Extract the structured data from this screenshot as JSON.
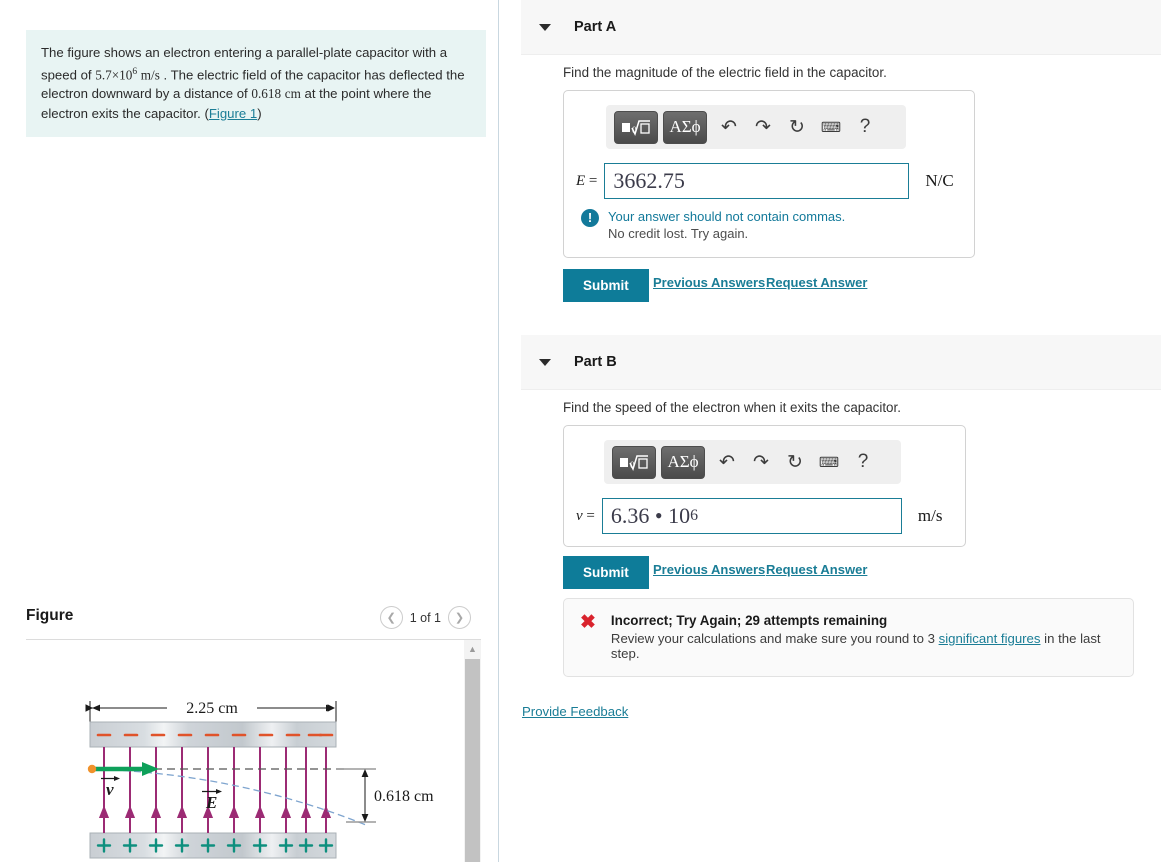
{
  "problem": {
    "text_1": "The figure shows an electron entering a parallel-plate capacitor with a speed of ",
    "speed_value": "5.7×10",
    "speed_exp": "6",
    "speed_unit": "m/s",
    "text_2": " . The electric field of the capacitor has deflected the electron downward by a distance of ",
    "distance_value": "0.618",
    "distance_unit": "cm",
    "text_3": " at the point where the electron exits the capacitor. (",
    "figure_link": "Figure 1",
    "text_4": ")"
  },
  "figure": {
    "title": "Figure",
    "counter": "1 of 1",
    "prev_icon": "chevron-left-icon",
    "next_icon": "chevron-right-icon",
    "scroll_up_icon": "triangle-up-icon",
    "labels": {
      "width": "2.25 cm",
      "deflection": "0.618 cm",
      "velocity": "v",
      "field": "E",
      "top_charge": "−",
      "bottom_charge": "+"
    },
    "colors": {
      "plate_fill": "#c6ccd1",
      "field_line": "#9c2b74",
      "velocity_arrow": "#0ea05a",
      "electron": "#f0922b",
      "minus_sign": "#e0532a",
      "plus_sign": "#0e8f7e",
      "trajectory": "#7fa5cf"
    }
  },
  "mathbar": {
    "template_label": "√□",
    "greek_label": "ΑΣϕ",
    "undo_icon": "undo-arrow-icon",
    "redo_icon": "redo-arrow-icon",
    "reset_icon": "reset-circular-arrow-icon",
    "keyboard_icon": "keyboard-icon",
    "help_icon": "question-mark-icon"
  },
  "part_a": {
    "caret_icon": "caret-down-icon",
    "title": "Part A",
    "prompt": "Find the magnitude of the electric field in the capacitor.",
    "field_label": "E",
    "field_equals": "=",
    "field_value": "3662.75",
    "field_unit": "N/C",
    "feedback_icon": "info-exclamation-icon",
    "feedback_line1": "Your answer should not contain commas.",
    "feedback_line2": "No credit lost. Try again.",
    "submit_label": "Submit",
    "previous_answers_label": "Previous Answers",
    "request_answer_label": "Request Answer"
  },
  "part_b": {
    "caret_icon": "caret-down-icon",
    "title": "Part B",
    "prompt": "Find the speed of the electron when it exits the capacitor.",
    "field_label": "v",
    "field_equals": "=",
    "field_value": "6.36 • 10",
    "field_value_exp": "6",
    "field_unit": "m/s",
    "submit_label": "Submit",
    "previous_answers_label": "Previous Answers",
    "request_answer_label": "Request Answer"
  },
  "incorrect": {
    "x_icon": "red-x-icon",
    "title": "Incorrect; Try Again; 29 attempts remaining",
    "sub_before": "Review your calculations and make sure you round to 3 ",
    "sub_link": "significant figures",
    "sub_after": " in the last step."
  },
  "footer": {
    "provide_feedback": "Provide Feedback"
  },
  "theme": {
    "accent": "#1a7d96",
    "submit_bg": "#0e7c99",
    "problem_bg": "#e8f4f3",
    "part_header_bg": "#f7f7f7",
    "error_red": "#d9232d"
  }
}
